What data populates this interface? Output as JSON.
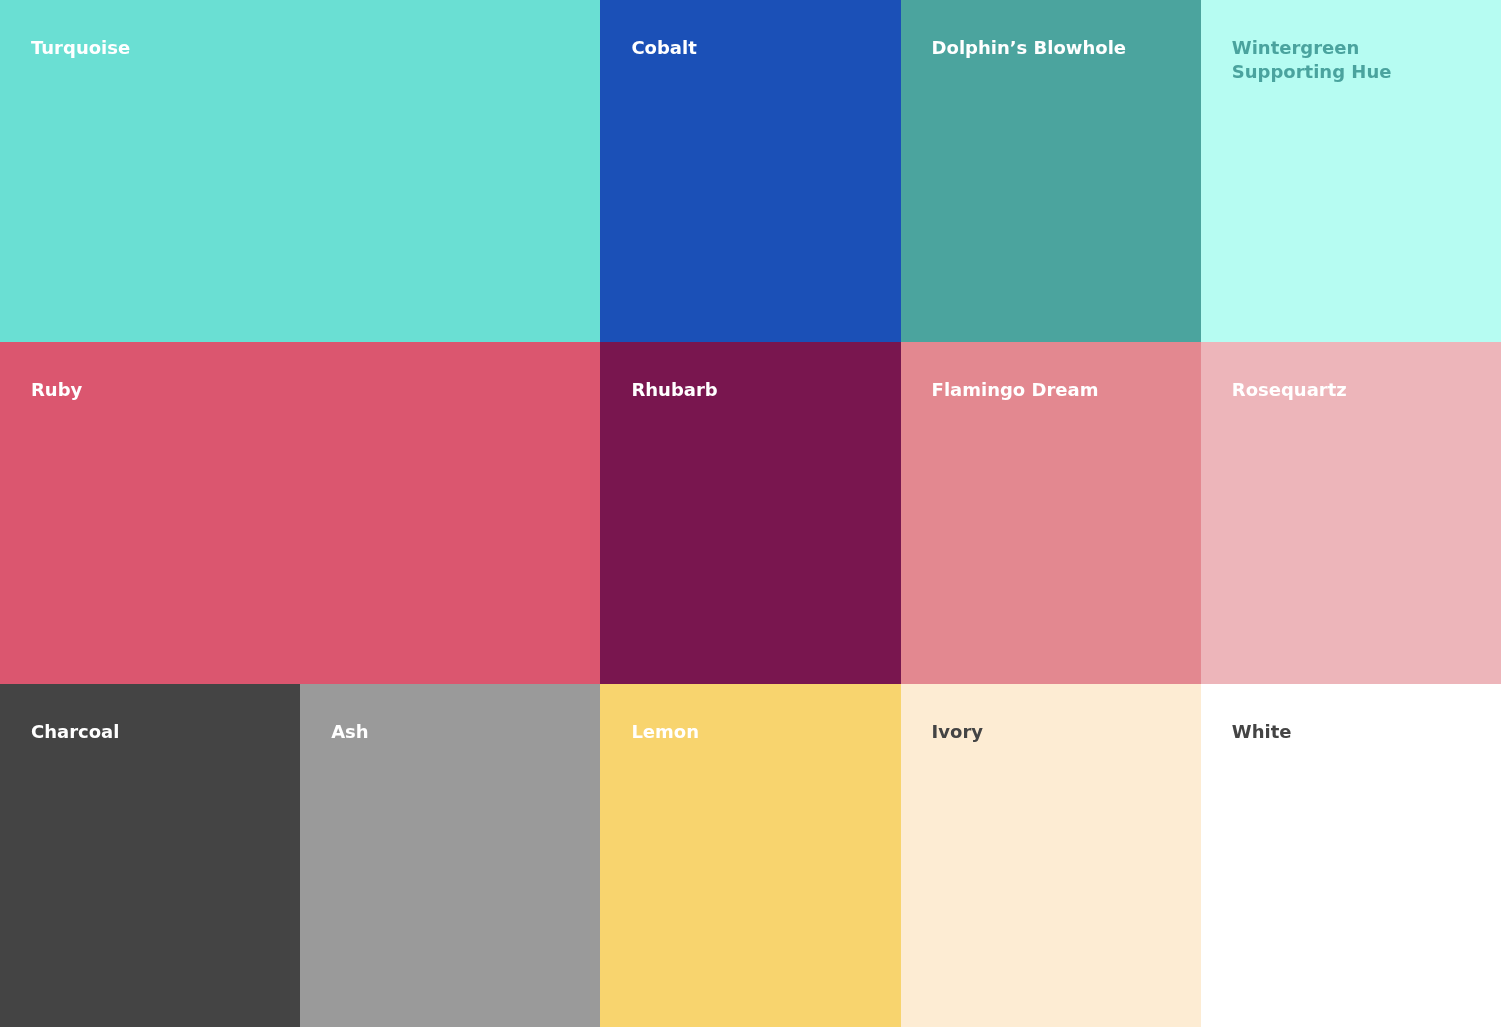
{
  "swatches": [
    {
      "name": "Turquoise",
      "color": "#6adfd3",
      "kind": "light-text",
      "wide": true
    },
    {
      "name": "Cobalt",
      "color": "#1b50b7",
      "kind": "light-text",
      "wide": false
    },
    {
      "name": "Dolphin’s Blowhole",
      "color": "#4ba49e",
      "kind": "light-text",
      "wide": false
    },
    {
      "name": "Wintergreen Supporting Hue",
      "color": "#b6fcf2",
      "kind": "tinted-text",
      "wide": false
    },
    {
      "name": "Ruby",
      "color": "#db566f",
      "kind": "light-text",
      "wide": true
    },
    {
      "name": "Rhubarb",
      "color": "#79164f",
      "kind": "light-text",
      "wide": false
    },
    {
      "name": "Flamingo Dream",
      "color": "#e38890",
      "kind": "light-text",
      "wide": false
    },
    {
      "name": "Rosequartz",
      "color": "#edb5ba",
      "kind": "light-text",
      "wide": false
    },
    {
      "name": "Charcoal",
      "color": "#444444",
      "kind": "light-text",
      "wide": false
    },
    {
      "name": "Ash",
      "color": "#9a9a9a",
      "kind": "light-text",
      "wide": false
    },
    {
      "name": "Lemon",
      "color": "#f8d46e",
      "kind": "light-text",
      "wide": false
    },
    {
      "name": "Ivory",
      "color": "#fdecd3",
      "kind": "dark-text",
      "wide": false
    },
    {
      "name": "White",
      "color": "#ffffff",
      "kind": "dark-text",
      "wide": false
    }
  ]
}
